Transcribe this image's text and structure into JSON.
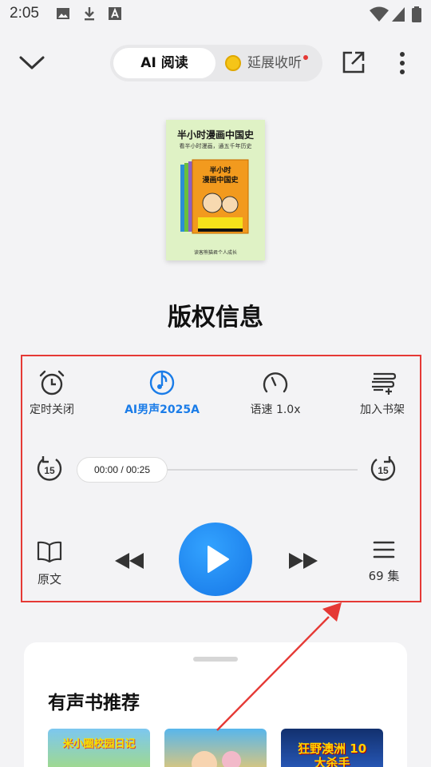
{
  "status_bar": {
    "time": "2:05"
  },
  "header": {
    "tab_ai_read": "AI 阅读",
    "tab_extended": "延展收听"
  },
  "cover": {
    "title": "半小时漫画中国史",
    "subtitle": "看半小时漫画，通五千年历史",
    "inner_title": "半小时漫画中国史",
    "banner": "看半小时漫画 通五千年历史",
    "publisher": "读客熊猫君个人成长"
  },
  "book_title": "版权信息",
  "controls": {
    "timer_label": "定时关闭",
    "voice_label": "AI男声2025A",
    "speed_label": "语速 1.0x",
    "shelf_label": "加入书架"
  },
  "progress": {
    "time_display": "00:00 / 00:25",
    "played_fraction": 0,
    "skip_seconds": "15"
  },
  "playback": {
    "original_label": "原文",
    "episodes_label": "69 集"
  },
  "recommend": {
    "title": "有声书推荐",
    "books": [
      {
        "title": "米小圈校园日记"
      },
      {
        "title": ""
      },
      {
        "title": "狂野澳洲 10大杀手"
      }
    ]
  },
  "colors": {
    "accent": "#1a7ce8",
    "annotation": "#e53935",
    "background": "#f3f3f5"
  }
}
